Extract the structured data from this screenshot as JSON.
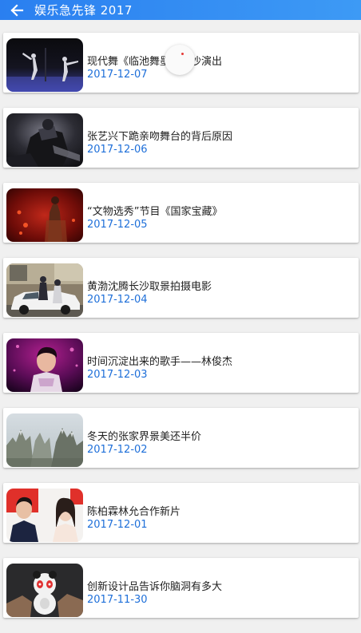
{
  "app_bar": {
    "title": "娱乐急先锋 2017",
    "back_icon": "arrow-left-icon",
    "color": "#3d8ff2"
  },
  "news": [
    {
      "title": "现代舞《临池舞墨》长沙演出",
      "date": "2017-12-07"
    },
    {
      "title": "张艺兴下跪亲吻舞台的背后原因",
      "date": "2017-12-06"
    },
    {
      "title": "“文物选秀”节目《国家宝藏》",
      "date": "2017-12-05"
    },
    {
      "title": "黄渤沈腾长沙取景拍摄电影",
      "date": "2017-12-04"
    },
    {
      "title": "时间沉淀出来的歌手——林俊杰",
      "date": "2017-12-03"
    },
    {
      "title": "冬天的张家界景美还半价",
      "date": "2017-12-02"
    },
    {
      "title": "陈柏霖林允合作新片",
      "date": "2017-12-01"
    },
    {
      "title": "创新设计品告诉你脑洞有多大",
      "date": "2017-11-30"
    }
  ],
  "loading_indicator": {
    "icon": "refresh-spinner-icon",
    "accent": "#e53935"
  },
  "colors": {
    "date_text": "#1e6fd9",
    "background": "#f0f0f0"
  }
}
